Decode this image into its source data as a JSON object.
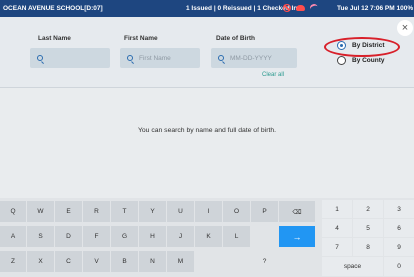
{
  "status": {
    "school": "OCEAN AVENUE SCHOOL[D:07]",
    "counts": "1 Issued | 0 Reissued | 1 Checked In",
    "datetime": "Tue Jul 12  7:06 PM  100%",
    "icons": [
      "ban-icon",
      "cloud-icon",
      "wifi-icon"
    ]
  },
  "search": {
    "last_name": {
      "label": "Last Name",
      "placeholder": ""
    },
    "first_name": {
      "label": "First Name",
      "placeholder": "First Name"
    },
    "dob": {
      "label": "Date of Birth",
      "placeholder": "MM-DD-YYYY"
    },
    "clear_all": "Clear all",
    "scope": {
      "options": [
        "By District",
        "By County"
      ],
      "selected": "By District"
    },
    "close_label": "×"
  },
  "main": {
    "hint": "You can search by name and full date of birth."
  },
  "keyboard": {
    "rows": [
      [
        "Q",
        "W",
        "E",
        "R",
        "T",
        "Y",
        "U",
        "I",
        "O",
        "P",
        "⌫"
      ],
      [
        "A",
        "S",
        "D",
        "F",
        "G",
        "H",
        "J",
        "K",
        "L",
        "",
        "→"
      ],
      [
        "Z",
        "X",
        "C",
        "V",
        "B",
        "N",
        "M",
        "",
        "",
        "?",
        ""
      ]
    ],
    "numpad": [
      [
        "1",
        "2",
        "3"
      ],
      [
        "4",
        "5",
        "6"
      ],
      [
        "7",
        "8",
        "9"
      ],
      [
        "space",
        "0"
      ]
    ]
  },
  "colors": {
    "status_bar": "#1e4680",
    "accent": "#2196f3",
    "highlight": "#d8202a",
    "link": "#2a9a8f"
  }
}
